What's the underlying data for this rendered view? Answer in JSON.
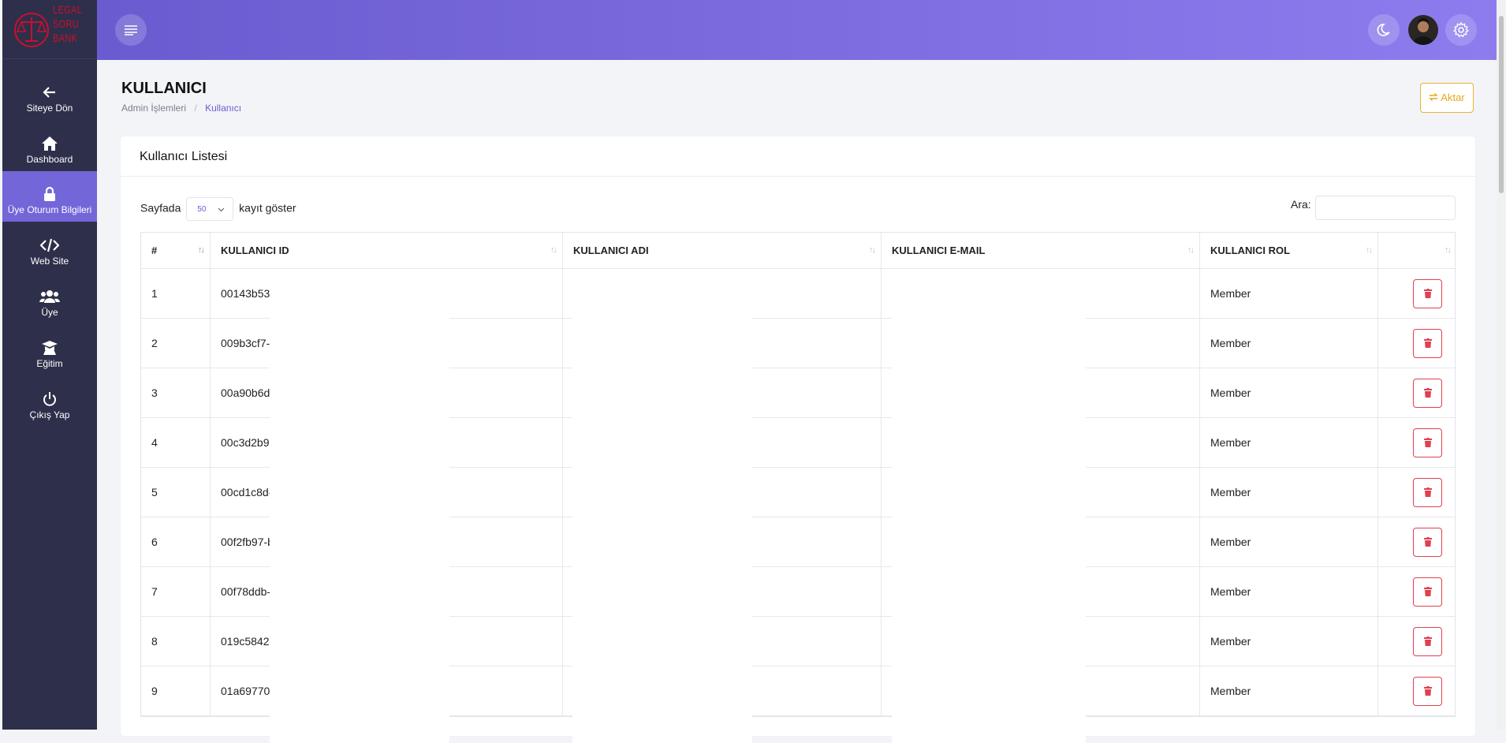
{
  "logo": {
    "line1": "LEGAL",
    "line2": "SORU",
    "line3": "BANK"
  },
  "sidebar": {
    "items": [
      {
        "label": "Siteye Dön",
        "icon": "arrow-left-icon"
      },
      {
        "label": "Dashboard",
        "icon": "home-icon"
      },
      {
        "label": "Üye Oturum Bilgileri",
        "icon": "lock-icon"
      },
      {
        "label": "Web Site",
        "icon": "code-icon"
      },
      {
        "label": "Üye",
        "icon": "users-icon"
      },
      {
        "label": "Eğitim",
        "icon": "graduation-cap-icon"
      },
      {
        "label": "Çıkış Yap",
        "icon": "power-icon"
      }
    ]
  },
  "page": {
    "title": "KULLANICI",
    "breadcrumb": [
      "Admin İşlemleri",
      "Kullanıcı"
    ],
    "aktar_label": "Aktar"
  },
  "card": {
    "title": "Kullanıcı Listesi",
    "length_prefix": "Sayfada",
    "length_value": "50",
    "length_suffix": "kayıt göster",
    "search_label": "Ara:"
  },
  "table": {
    "headers": [
      "#",
      "KULLANICI ID",
      "KULLANICI ADI",
      "KULLANICI E-MAIL",
      "KULLANICI ROL",
      ""
    ],
    "rows": [
      {
        "n": "1",
        "id": "00143b53-",
        "role": "Member"
      },
      {
        "n": "2",
        "id": "009b3cf7-",
        "role": "Member"
      },
      {
        "n": "3",
        "id": "00a90b6d-",
        "role": "Member"
      },
      {
        "n": "4",
        "id": "00c3d2b9-",
        "role": "Member"
      },
      {
        "n": "5",
        "id": "00cd1c8d-",
        "role": "Member"
      },
      {
        "n": "6",
        "id": "00f2fb97-b",
        "role": "Member"
      },
      {
        "n": "7",
        "id": "00f78ddb-",
        "role": "Member"
      },
      {
        "n": "8",
        "id": "019c5842-",
        "role": "Member"
      },
      {
        "n": "9",
        "id": "01a69770-",
        "role": "Member"
      }
    ]
  },
  "colors": {
    "accent": "#6a5bd0",
    "sidebar": "#2e2f4a",
    "danger": "#e04050",
    "warning": "#e6a817"
  }
}
